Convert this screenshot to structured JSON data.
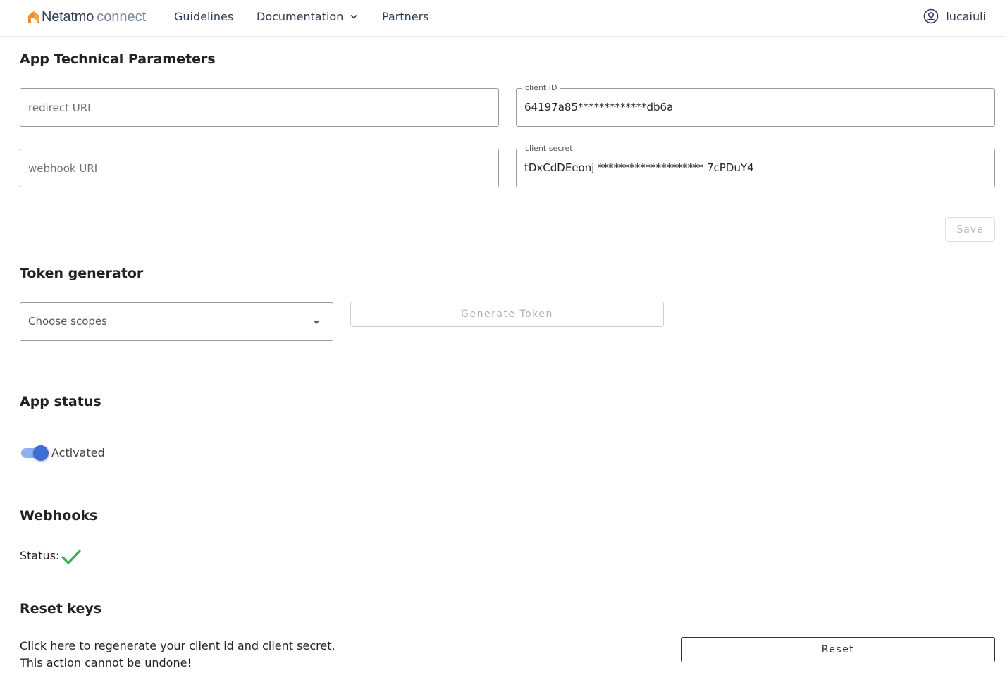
{
  "header": {
    "logo_main": "Netatmo",
    "logo_sub": "connect",
    "nav": {
      "guidelines": "Guidelines",
      "documentation": "Documentation",
      "partners": "Partners"
    },
    "user": "lucaiuli"
  },
  "tech_params": {
    "title": "App Technical Parameters",
    "redirect_uri": {
      "placeholder": "redirect URI",
      "value": ""
    },
    "webhook_uri": {
      "placeholder": "webhook URI",
      "value": ""
    },
    "client_id": {
      "label": "client ID",
      "value": "64197a85*************db6a"
    },
    "client_secret": {
      "label": "client secret",
      "value": "tDxCdDEeonj ******************** 7cPDuY4"
    },
    "save_label": "Save"
  },
  "token_generator": {
    "title": "Token generator",
    "scopes_placeholder": "Choose scopes",
    "generate_label": "Generate Token"
  },
  "app_status": {
    "title": "App status",
    "toggle_label": "Activated",
    "activated": true
  },
  "webhooks": {
    "title": "Webhooks",
    "status_label": "Status:"
  },
  "reset_keys": {
    "title": "Reset keys",
    "line1": "Click here to regenerate your client id and client secret.",
    "line2": "This action cannot be undone!",
    "reset_label": "Reset"
  },
  "colors": {
    "accent": "#3a6fd8",
    "logo_orange": "#f28c28",
    "success": "#3fae5a"
  },
  "icons": {
    "logo": "netatmo-house-icon",
    "chevron": "chevron-down-icon",
    "user": "user-circle-icon",
    "check": "check-icon",
    "caret": "caret-down-icon"
  }
}
